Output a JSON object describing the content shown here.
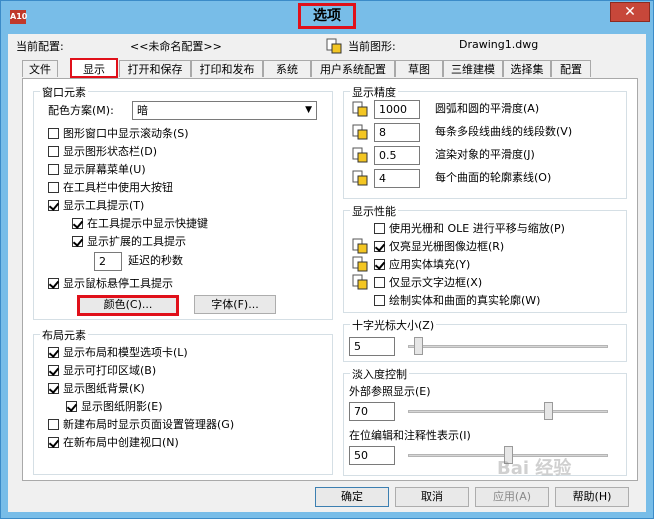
{
  "window": {
    "title": "选项",
    "app_icon_text": "A10",
    "close_symbol": "✕"
  },
  "config": {
    "current_profile_label": "当前配置:",
    "current_profile_value": "<<未命名配置>>",
    "current_drawing_label": "当前图形:",
    "current_drawing_value": "Drawing1.dwg"
  },
  "tabs": [
    {
      "label": "文件"
    },
    {
      "label": "显示"
    },
    {
      "label": "打开和保存"
    },
    {
      "label": "打印和发布"
    },
    {
      "label": "系统"
    },
    {
      "label": "用户系统配置"
    },
    {
      "label": "草图"
    },
    {
      "label": "三维建模"
    },
    {
      "label": "选择集"
    },
    {
      "label": "配置"
    }
  ],
  "window_elements": {
    "title": "窗口元素",
    "color_scheme_label": "配色方案(M):",
    "color_scheme_value": "暗",
    "items": [
      {
        "label": "图形窗口中显示滚动条(S)",
        "checked": false
      },
      {
        "label": "显示图形状态栏(D)",
        "checked": false
      },
      {
        "label": "显示屏幕菜单(U)",
        "checked": false
      },
      {
        "label": "在工具栏中使用大按钮",
        "checked": false
      },
      {
        "label": "显示工具提示(T)",
        "checked": true
      },
      {
        "label": "在工具提示中显示快捷键",
        "checked": true
      },
      {
        "label": "显示扩展的工具提示",
        "checked": true
      },
      {
        "label": "显示鼠标悬停工具提示",
        "checked": true
      }
    ],
    "delay_value": "2",
    "delay_label": "延迟的秒数",
    "colors_button": "颜色(C)...",
    "fonts_button": "字体(F)..."
  },
  "layout_elements": {
    "title": "布局元素",
    "items": [
      {
        "label": "显示布局和模型选项卡(L)",
        "checked": true
      },
      {
        "label": "显示可打印区域(B)",
        "checked": true
      },
      {
        "label": "显示图纸背景(K)",
        "checked": true
      },
      {
        "label": "显示图纸阴影(E)",
        "checked": true
      },
      {
        "label": "新建布局时显示页面设置管理器(G)",
        "checked": false
      },
      {
        "label": "在新布局中创建视口(N)",
        "checked": true
      }
    ]
  },
  "display_resolution": {
    "title": "显示精度",
    "items": [
      {
        "value": "1000",
        "label": "圆弧和圆的平滑度(A)"
      },
      {
        "value": "8",
        "label": "每条多段线曲线的线段数(V)"
      },
      {
        "value": "0.5",
        "label": "渲染对象的平滑度(J)"
      },
      {
        "value": "4",
        "label": "每个曲面的轮廓素线(O)"
      }
    ]
  },
  "display_performance": {
    "title": "显示性能",
    "items": [
      {
        "label": "使用光栅和 OLE 进行平移与缩放(P)",
        "checked": false
      },
      {
        "label": "仅亮显光栅图像边框(R)",
        "checked": true
      },
      {
        "label": "应用实体填充(Y)",
        "checked": true
      },
      {
        "label": "仅显示文字边框(X)",
        "checked": false
      },
      {
        "label": "绘制实体和曲面的真实轮廓(W)",
        "checked": false
      }
    ]
  },
  "crosshair": {
    "title": "十字光标大小(Z)",
    "value": "5",
    "level": 5
  },
  "fade": {
    "title": "淡入度控制",
    "xref_label": "外部参照显示(E)",
    "xref_value": "70",
    "xref_level": 70,
    "inplace_label": "在位编辑和注释性表示(I)",
    "inplace_value": "50",
    "inplace_level": 50
  },
  "footer": {
    "ok": "确定",
    "cancel": "取消",
    "apply": "应用(A)",
    "help": "帮助(H)"
  },
  "watermark": "Bai 经验"
}
